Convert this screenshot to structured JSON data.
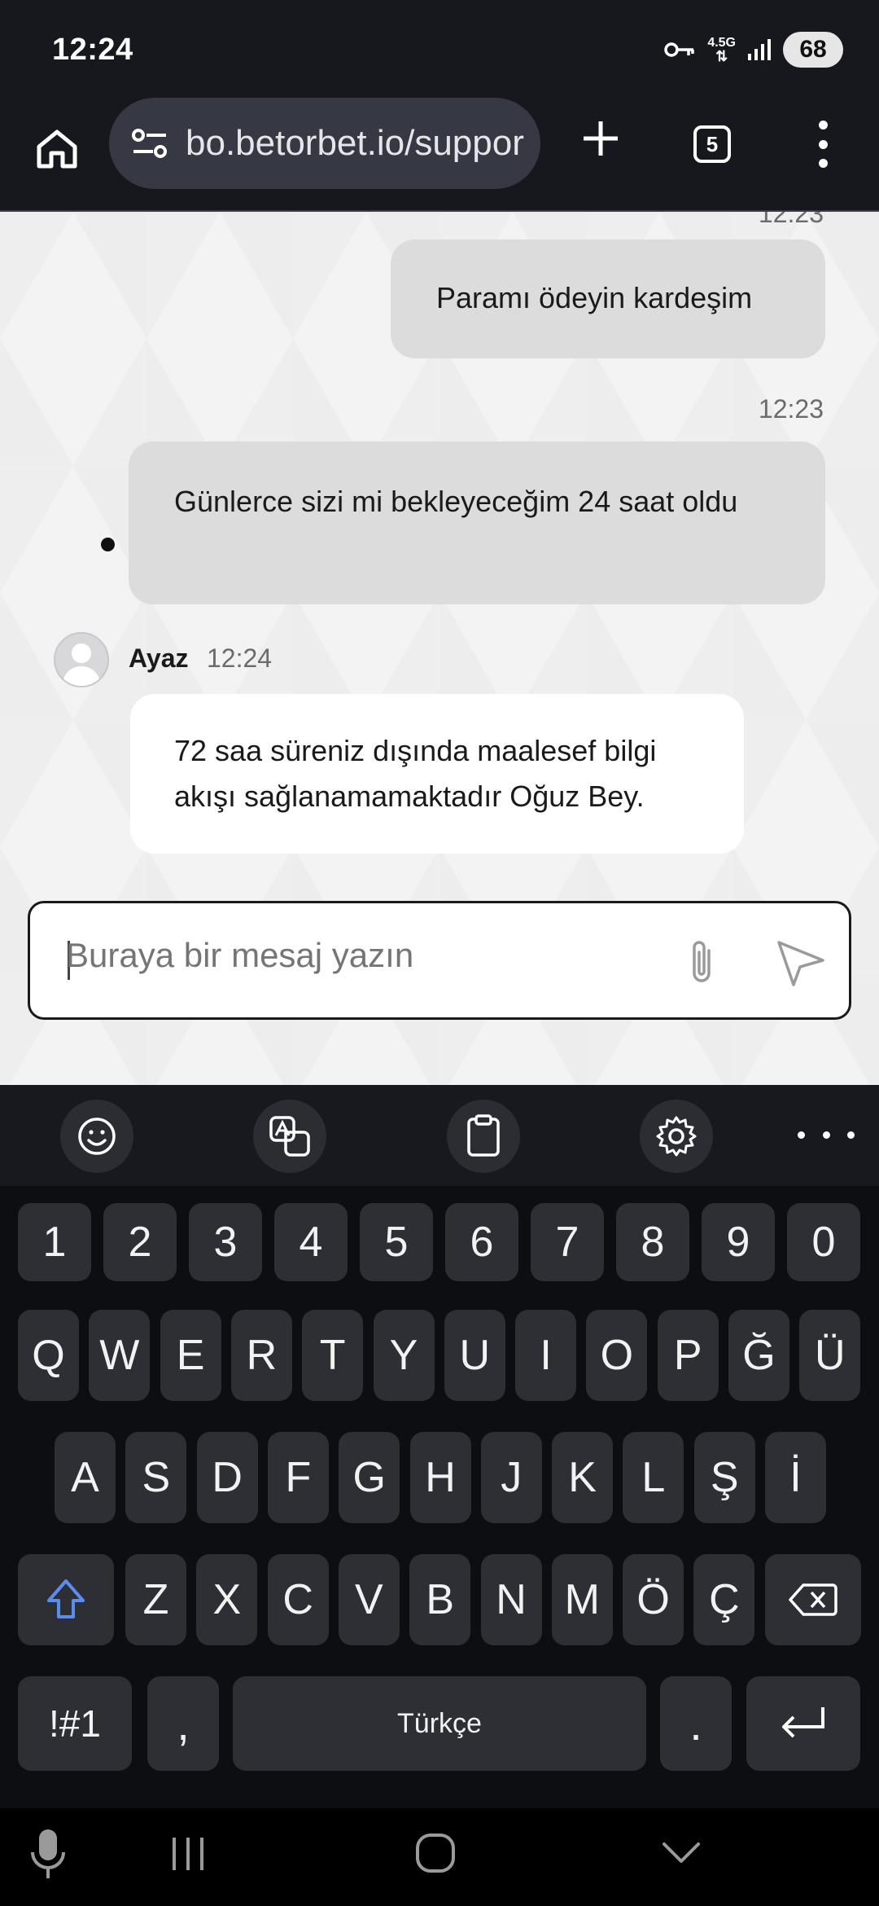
{
  "status_bar": {
    "time": "12:24",
    "network": "4.5G",
    "battery": "68"
  },
  "browser": {
    "url": "bo.betorbet.io/support",
    "tab_count": "5"
  },
  "chat": {
    "partial_timestamp": "12:23",
    "messages": [
      {
        "text": "Paramı ödeyin kardeşim"
      },
      {
        "time": "12:23",
        "text": "Günlerce sizi mi bekleyeceğim 24 saat oldu"
      },
      {
        "sender": "Ayaz",
        "time": "12:24",
        "text": "72 saa süreniz dışında maalesef bilgi akışı sağlanamamaktadır Oğuz Bey."
      }
    ],
    "composer": {
      "placeholder": "Buraya bir mesaj yazın"
    }
  },
  "keyboard": {
    "number_row": [
      "1",
      "2",
      "3",
      "4",
      "5",
      "6",
      "7",
      "8",
      "9",
      "0"
    ],
    "row1": [
      "Q",
      "W",
      "E",
      "R",
      "T",
      "Y",
      "U",
      "I",
      "O",
      "P",
      "Ğ",
      "Ü"
    ],
    "row2": [
      "A",
      "S",
      "D",
      "F",
      "G",
      "H",
      "J",
      "K",
      "L",
      "Ş",
      "İ"
    ],
    "row3": [
      "Z",
      "X",
      "C",
      "V",
      "B",
      "N",
      "M",
      "Ö",
      "Ç"
    ],
    "symbols_label": "!#1",
    "comma": ",",
    "space_label": "Türkçe",
    "period": "."
  }
}
